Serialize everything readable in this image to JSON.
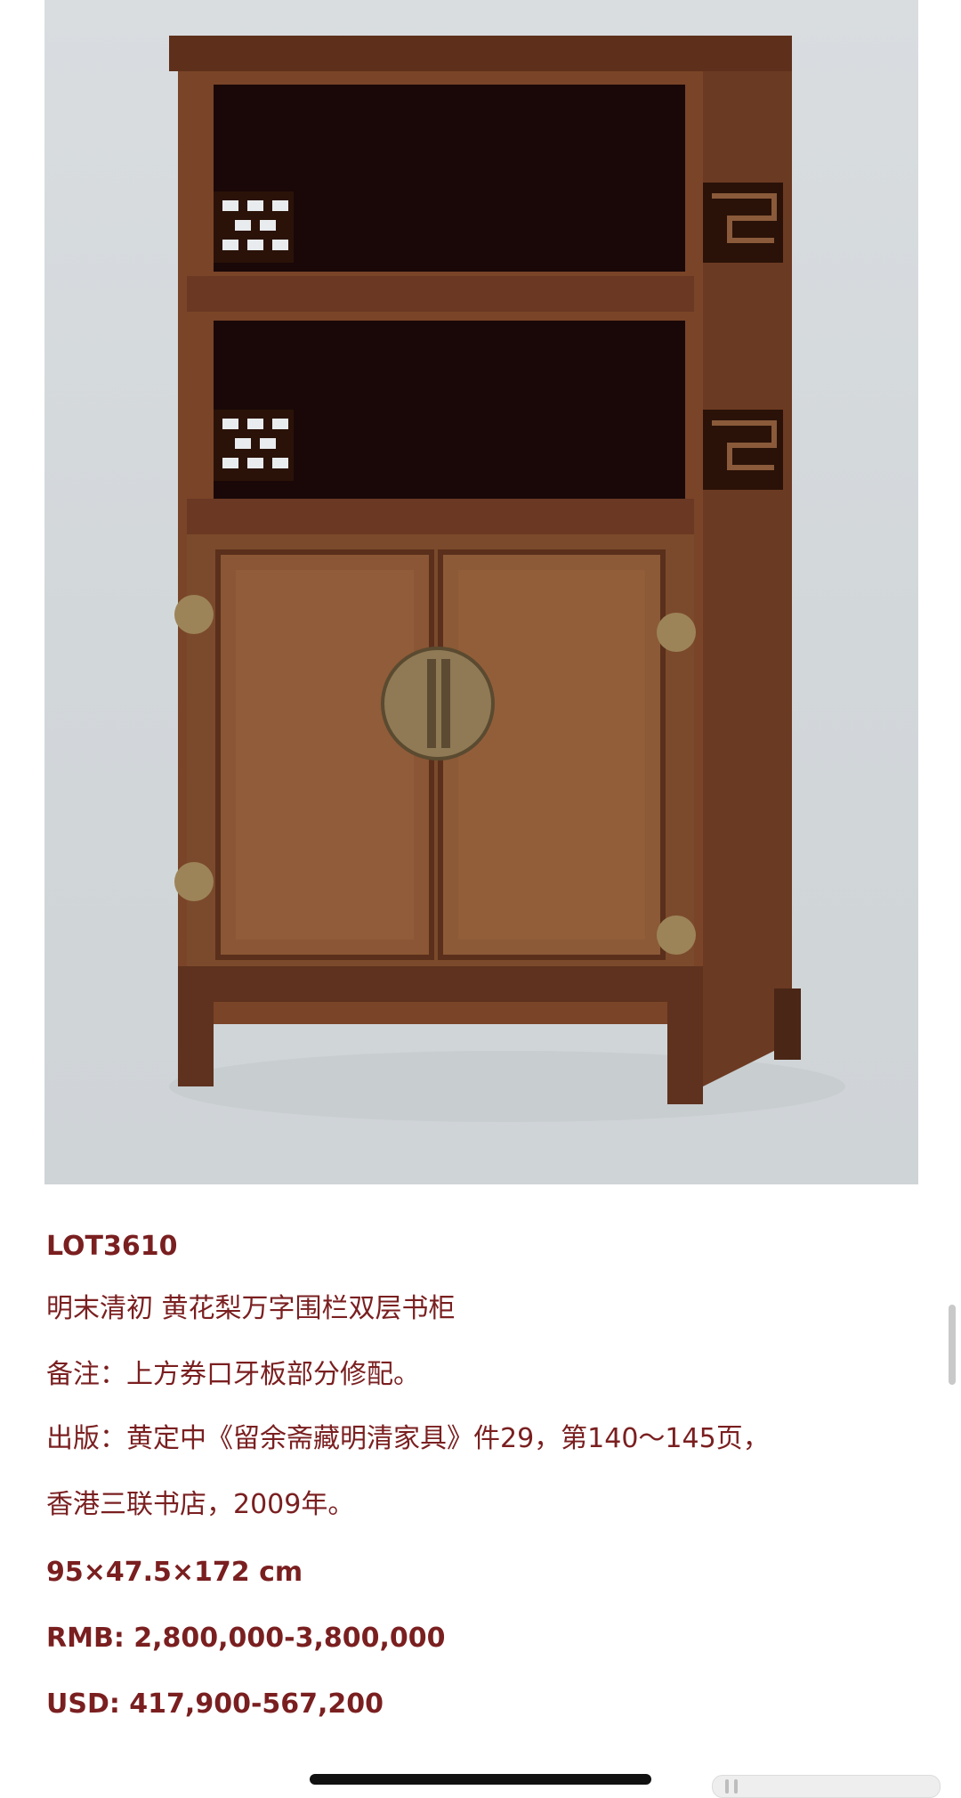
{
  "image": {
    "subject": "cabinet-photo"
  },
  "lot": {
    "number": "LOT3610",
    "title": "明末清初  黄花梨万字围栏双层书柜",
    "note": "备注：上方券口牙板部分修配。",
    "publication_line1": "出版：黄定中《留余斋藏明清家具》件29，第140～145页，",
    "publication_line2": "香港三联书店，2009年。",
    "dimensions": "95×47.5×172 cm",
    "price_rmb": "RMB: 2,800,000-3,800,000",
    "price_usd": "USD: 417,900-567,200"
  },
  "colors": {
    "text": "#7a1f20",
    "background": "#ffffff"
  }
}
